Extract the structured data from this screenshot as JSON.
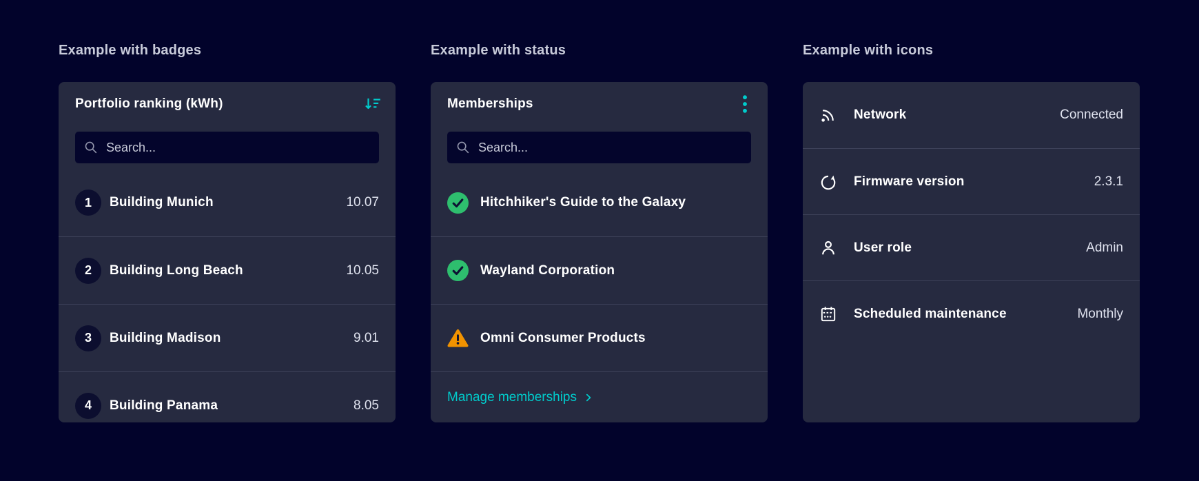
{
  "colors": {
    "background": "#02032B",
    "card": "#262A40",
    "accent": "#00CCCC",
    "success": "#2EBE6E",
    "warning": "#F19200"
  },
  "sections": [
    {
      "heading": "Example with badges",
      "card": {
        "title": "Portfolio ranking (kWh)",
        "header_icon": "sort-descending-icon",
        "search": {
          "placeholder": "Search...",
          "icon": "search-icon"
        },
        "rows": [
          {
            "badge": "1",
            "label": "Building Munich",
            "value": "10.07"
          },
          {
            "badge": "2",
            "label": "Building Long Beach",
            "value": "10.05"
          },
          {
            "badge": "3",
            "label": "Building Madison",
            "value": "9.01"
          },
          {
            "badge": "4",
            "label": "Building Panama",
            "value": "8.05"
          }
        ]
      }
    },
    {
      "heading": "Example with status",
      "card": {
        "title": "Memberships",
        "header_icon": "kebab-menu-icon",
        "search": {
          "placeholder": "Search...",
          "icon": "search-icon"
        },
        "rows": [
          {
            "status": "success",
            "icon": "check-circle-icon",
            "label": "Hitchhiker's Guide to the Galaxy"
          },
          {
            "status": "success",
            "icon": "check-circle-icon",
            "label": "Wayland Corporation"
          },
          {
            "status": "warning",
            "icon": "warning-triangle-icon",
            "label": "Omni Consumer Products"
          }
        ],
        "footer_link": {
          "label": "Manage memberships",
          "icon": "chevron-right-icon"
        }
      }
    },
    {
      "heading": "Example with icons",
      "card": {
        "rows": [
          {
            "icon": "network-icon",
            "label": "Network",
            "value": "Connected"
          },
          {
            "icon": "refresh-icon",
            "label": "Firmware version",
            "value": "2.3.1"
          },
          {
            "icon": "user-icon",
            "label": "User role",
            "value": "Admin"
          },
          {
            "icon": "calendar-icon",
            "label": "Scheduled maintenance",
            "value": "Monthly"
          }
        ]
      }
    }
  ]
}
